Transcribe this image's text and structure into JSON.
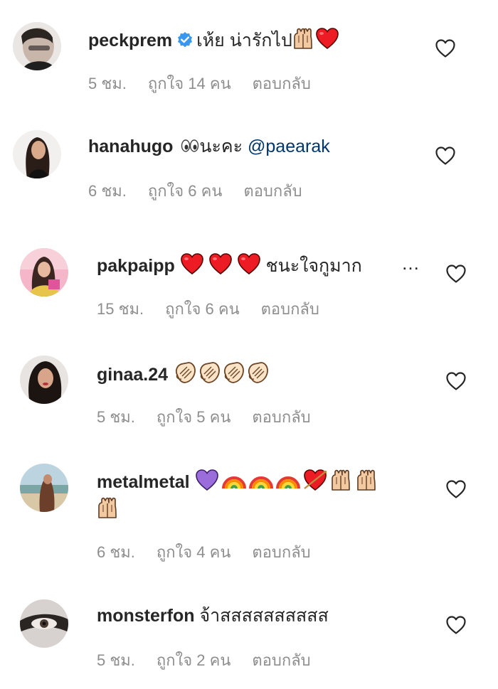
{
  "comments": [
    {
      "username": "peckprem",
      "text": "เห้ย น่ารักไป",
      "time": "5 ชม.",
      "likes": "ถูกใจ 14 คน",
      "reply": "ตอบกลับ"
    },
    {
      "username": "hanahugo",
      "text": "นะคะ",
      "mention": "@paearak",
      "time": "6 ชม.",
      "likes": "ถูกใจ 6 คน",
      "reply": "ตอบกลับ"
    },
    {
      "username": "pakpaipp",
      "text": "ชนะใจกูมาก",
      "more": "…",
      "time": "15 ชม.",
      "likes": "ถูกใจ 6 คน",
      "reply": "ตอบกลับ"
    },
    {
      "username": "ginaa.24",
      "time": "5 ชม.",
      "likes": "ถูกใจ 5 คน",
      "reply": "ตอบกลับ"
    },
    {
      "username": "metalmetal",
      "time": "6 ชม.",
      "likes": "ถูกใจ 4 คน",
      "reply": "ตอบกลับ"
    },
    {
      "username": "monsterfon",
      "text": "จ้าสสสสสสสสสส",
      "time": "5 ชม.",
      "likes": "ถูกใจ 2 คน",
      "reply": "ตอบกลับ"
    }
  ],
  "icons": {
    "like": "heart-outline-icon",
    "verified": "verified-badge-icon"
  },
  "colors": {
    "username": "#262626",
    "meta": "#8e8e8e",
    "mention": "#00376b",
    "verified": "#3897f0",
    "heart": "#ed1c24"
  }
}
